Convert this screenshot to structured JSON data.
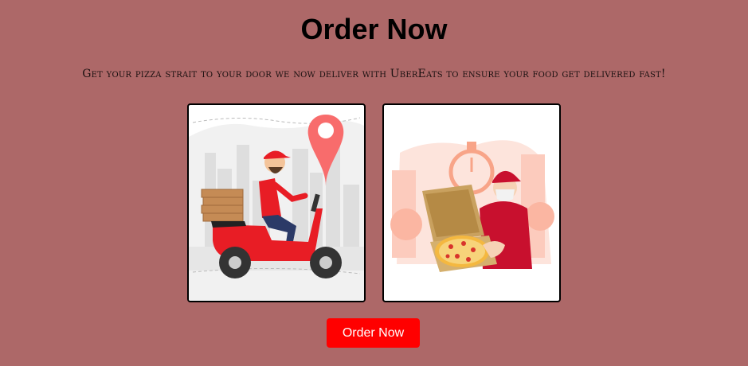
{
  "heading": "Order Now",
  "subtitle": "Get your pizza strait to your door we now deliver with UberEats to ensure your food get delivered fast!",
  "cards": [
    {
      "illustration": "scooter-delivery-illustration"
    },
    {
      "illustration": "pizza-box-delivery-illustration"
    }
  ],
  "order_button": "Order Now",
  "colors": {
    "background": "#ad6868",
    "button": "#ff0000",
    "button_text": "#ffffff",
    "accent_red": "#e81d25"
  }
}
